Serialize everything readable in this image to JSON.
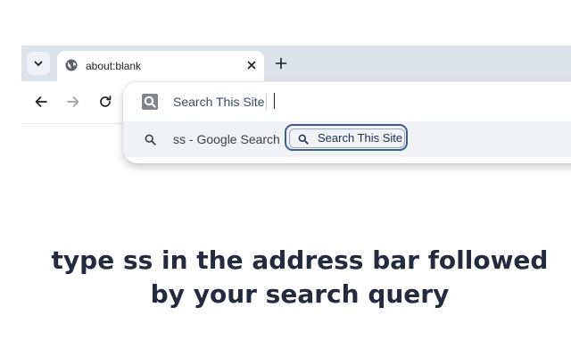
{
  "browser": {
    "tab": {
      "title": "about:blank",
      "favicon": "globe-icon"
    },
    "tab_list_icon": "chevron-down-icon",
    "new_tab_icon": "plus-icon",
    "nav": {
      "back_icon": "arrow-left-icon",
      "forward_icon": "arrow-right-icon",
      "reload_icon": "reload-icon"
    }
  },
  "omnibox": {
    "keyword_label": "Search This Site",
    "keyword_icon": "site-search-icon",
    "suggestion": {
      "text": "ss - Google Search",
      "icon": "search-icon"
    },
    "chip": {
      "label": "Search This Site",
      "icon": "search-icon"
    },
    "colors": {
      "chip_border": "#3d5f95",
      "suggestion_bg": "#f0f2f5"
    }
  },
  "page": {
    "headline_line1": "type ss in the address bar followed",
    "headline_line2": "by your search query"
  },
  "colors": {
    "tabbar_bg": "#dee3ea",
    "headline": "#252a3f"
  }
}
